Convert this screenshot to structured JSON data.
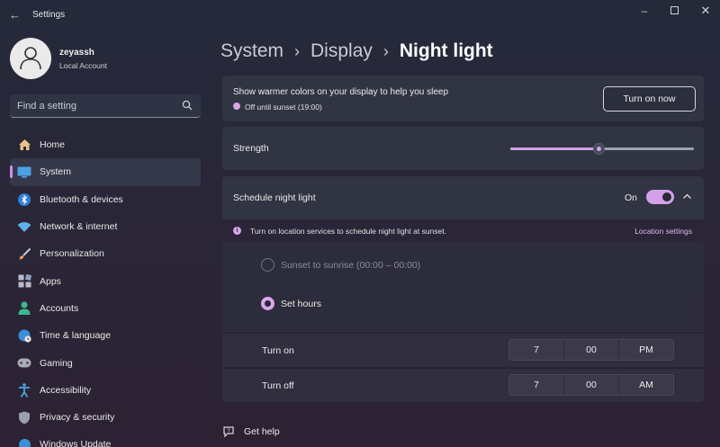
{
  "window": {
    "title": "Settings",
    "back_icon": "arrow-left-icon",
    "controls": [
      "minimize",
      "maximize",
      "close"
    ]
  },
  "profile": {
    "name": "zeyassh",
    "account_type": "Local Account"
  },
  "search": {
    "placeholder": "Find a setting"
  },
  "sidebar": {
    "items": [
      {
        "label": "Home",
        "icon": "home-icon"
      },
      {
        "label": "System",
        "icon": "monitor-icon",
        "selected": true
      },
      {
        "label": "Bluetooth & devices",
        "icon": "bluetooth-icon"
      },
      {
        "label": "Network & internet",
        "icon": "wifi-icon"
      },
      {
        "label": "Personalization",
        "icon": "brush-icon"
      },
      {
        "label": "Apps",
        "icon": "apps-icon"
      },
      {
        "label": "Accounts",
        "icon": "person-icon"
      },
      {
        "label": "Time & language",
        "icon": "globe-clock-icon"
      },
      {
        "label": "Gaming",
        "icon": "gamepad-icon"
      },
      {
        "label": "Accessibility",
        "icon": "accessibility-icon"
      },
      {
        "label": "Privacy & security",
        "icon": "shield-icon"
      },
      {
        "label": "Windows Update",
        "icon": "update-icon"
      }
    ]
  },
  "breadcrumb": {
    "items": [
      "System",
      "Display"
    ],
    "current": "Night light"
  },
  "night_light": {
    "description": "Show warmer colors on your display to help you sleep",
    "status": "Off until sunset (19:00)",
    "turn_on_button": "Turn on now"
  },
  "strength": {
    "label": "Strength",
    "value_fraction": 0.48
  },
  "schedule": {
    "label": "Schedule night light",
    "toggle_label": "On",
    "toggle_on": true,
    "notice": "Turn on location services to schedule night light at sunset.",
    "location_link": "Location settings",
    "option_sunset": "Sunset to sunrise (00:00 – 00:00)",
    "option_hours": "Set hours",
    "turn_on": {
      "label": "Turn on",
      "hour": "7",
      "minute": "00",
      "period": "PM"
    },
    "turn_off": {
      "label": "Turn off",
      "hour": "7",
      "minute": "00",
      "period": "AM"
    }
  },
  "help": {
    "label": "Get help"
  },
  "colors": {
    "accent": "#d4a0ea",
    "card": "#303443",
    "background": "#262a38"
  }
}
